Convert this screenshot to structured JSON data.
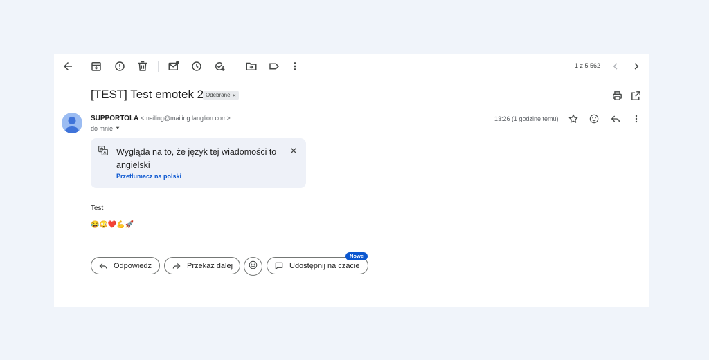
{
  "toolbar": {
    "back_icon": "arrow-left-icon",
    "archive_icon": "archive-icon",
    "report_icon": "report-spam-icon",
    "delete_icon": "trash-icon",
    "unread_icon": "mark-unread-icon",
    "snooze_icon": "clock-icon",
    "task_icon": "add-task-icon",
    "move_icon": "move-to-folder-icon",
    "label_icon": "label-icon",
    "more_icon": "more-vertical-icon",
    "pager": "1 z 5 562"
  },
  "email": {
    "subject": "[TEST] Test emotek 2",
    "label": "Odebrane",
    "label_close": "×",
    "sender_name": "SUPPORTOLA",
    "sender_email": "<mailing@mailing.langlion.com>",
    "to": "do mnie",
    "time": "13:26 (1 godzinę temu)",
    "body": "Test",
    "emojis": "😂😳❤️💪🚀"
  },
  "translate": {
    "message": "Wygląda na to, że język tej wiadomości to angielski",
    "link": "Przetłumacz na polski"
  },
  "actions": {
    "reply": "Odpowiedz",
    "forward": "Przekaż dalej",
    "share": "Udostępnij na czacie",
    "badge": "Nowe"
  },
  "colors": {
    "accent": "#0b57d0",
    "background": "#f0f4fa",
    "translate_bg": "#eef1f8",
    "avatar": "#9bbcf2"
  }
}
